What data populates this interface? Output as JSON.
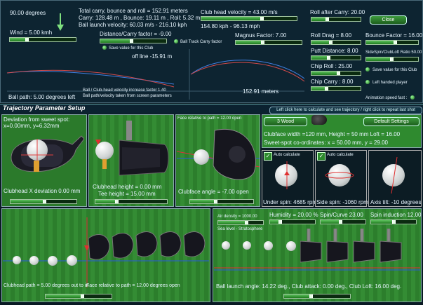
{
  "top": {
    "angle_label": "90.00 degrees",
    "carry_lines": [
      "Total carry, bounce and roll = 152.91 meters",
      "Carry: 128.48 m , Bounce: 19.11 m , Roll: 5.32 m",
      "Ball launch velocity: 60.03 m/s - 216.10 kph"
    ],
    "club_head_velocity": "Club head velocity = 43.00 m/s",
    "kph_mph": "154.80 kph   - 96.13 mph",
    "roll_after_carry": "Roll after Carry: 20.00",
    "close_button": "Close",
    "wind": "Wind = 5.00 kmh",
    "distance_carry_factor": "Distance/Carry factor = -9.00",
    "save_value": "Save value for this Club",
    "ball_track": "Ball Track Carry factor",
    "magnus_factor": "Magnus Factor: 7.00",
    "roll_drag": "Roll Drag = 8.00",
    "bounce_factor": "Bounce Factor = 16.00",
    "off_line": "off line -15.91 m",
    "putt_distance": "Putt Distance: 8.00",
    "sidespin_ratio": "SideSpin/ClubLoft Ratio 50.00",
    "save_value2": "Save value for this Club",
    "chip_roll": "Chip Roll : 25.00",
    "chip_carry": "Chip Carry : 8.00",
    "left_handed": "Left handed player",
    "ball_path": "Ball path: 5.00 degrees left",
    "increase_factor": "Ball / Club-head velocity increase factor 1.40",
    "ball_path_velocity": "Ball path/velocity taken from screen parameters",
    "distance_mark": "152.91 meters",
    "animation_speed": "Animation speed fast :"
  },
  "setup": {
    "title": "Trajectory Parameter Setup",
    "hint": "Left click here to calculate and see trajectory / right click to repeat last shot",
    "club_select": "3 Wood",
    "default_settings": "Default Settings",
    "clubface_dims": "Clubface width =120 mm,  Height = 50 mm      Loft = 16.00",
    "sweet_spot_coords": "Sweet-spot co-ordinates:  x = 50.00 mm,  y = 29.00",
    "deviation_title": "Deviation from sweet spot:",
    "deviation_xy": "x=0.00mm,   y=6.32mm",
    "clubhead_x_dev": "Clubhead X deviation 0.00 mm",
    "clubhead_height": "Clubhead height = 0.00 mm",
    "tee_height": "Tee height = 15.00 mm",
    "face_relative": "Face relative to path = 12.00 open",
    "clubface_angle": "Clubface angle = -7.00 open",
    "auto_calc": "Auto calculate",
    "auto_calc2": "Auto calculate",
    "under_spin": "Under spin: 4685 rpm",
    "side_spin": "Side spin: -1060 rpm",
    "axis_tilt": "Axis tilt: -10 degrees",
    "clubhead_path": "Clubhead path = 5.00 degrees out to in",
    "face_relative2": "Face relative to path = 12.00 degrees open",
    "air_density": "Air density = 1000.00",
    "sea_level": "Sea level  -  Stratosphere",
    "humidity": "Humidity = 20.00 %",
    "spin_curve": "Spin/Curve 23.00",
    "spin_induction": "Spin induction 12.00",
    "ball_launch": "Ball launch angle: 14.22 deg., Club attack: 0.00 deg., Club Loft: 16.00 deg."
  },
  "colors": {
    "bg": "#0a1a24",
    "green": "#2f8a2f",
    "accent": "#b8ff7a"
  }
}
